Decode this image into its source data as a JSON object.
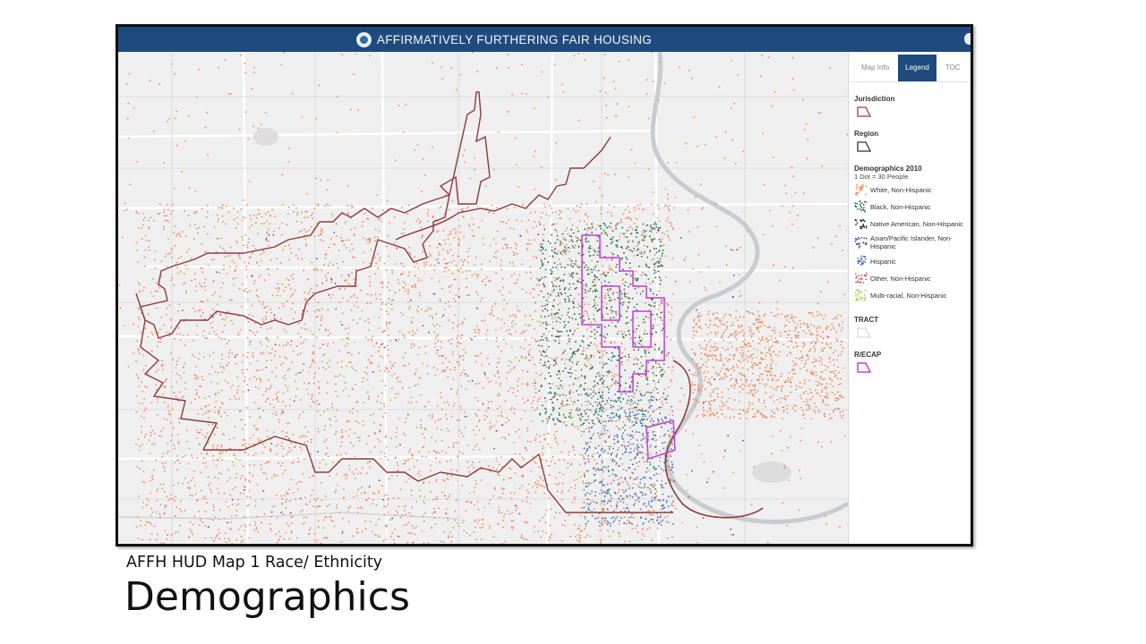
{
  "app": {
    "title": "AFFIRMATIVELY FURTHERING FAIR HOUSING"
  },
  "panel": {
    "tabs": [
      {
        "label": "Map Info",
        "active": false
      },
      {
        "label": "Legend",
        "active": true
      },
      {
        "label": "TOC",
        "active": false
      }
    ]
  },
  "legend": {
    "jurisdiction": {
      "title": "Jurisdiction",
      "color": "#9a3b3b"
    },
    "region": {
      "title": "Region",
      "color": "#333333"
    },
    "demographics": {
      "title": "Demographics 2010",
      "note": "1 Dot = 30 People",
      "items": [
        {
          "label": "White, Non-Hispanic",
          "color": "#f0875a"
        },
        {
          "label": "Black, Non-Hispanic",
          "color": "#1f6b4f"
        },
        {
          "label": "Native American, Non-Hispanic",
          "color": "#333333"
        },
        {
          "label": "Asian/Pacific Islander, Non-Hispanic",
          "color": "#6a3b9e"
        },
        {
          "label": "Hispanic",
          "color": "#4a78b8"
        },
        {
          "label": "Other, Non-Hispanic",
          "color": "#d9484f"
        },
        {
          "label": "Multi-racial, Non-Hispanic",
          "color": "#8fd13c"
        }
      ]
    },
    "tract": {
      "title": "TRACT",
      "color": "#d8d8d8"
    },
    "recap": {
      "title": "R/ECAP",
      "color": "#c73dd6"
    }
  },
  "slide": {
    "subtitle": "AFFH HUD Map 1 Race/ Ethnicity",
    "title": "Demographics"
  }
}
